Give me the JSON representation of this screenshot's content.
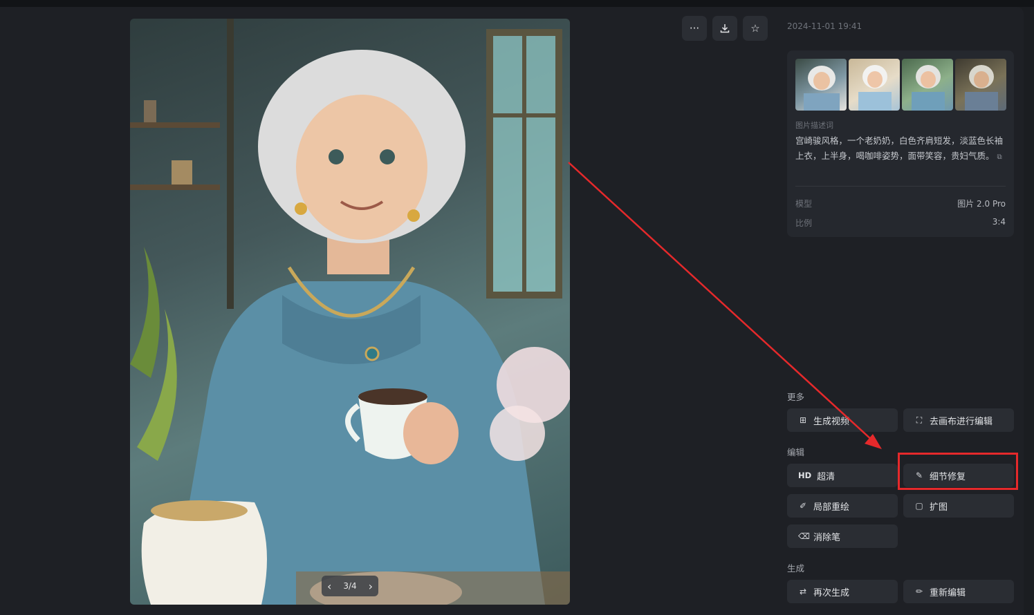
{
  "viewer": {
    "pager": {
      "current": "3/4",
      "prev_icon": "chevron-left-icon",
      "next_icon": "chevron-right-icon"
    }
  },
  "toolbar": {
    "more_icon": "ellipsis-icon",
    "download_icon": "download-icon",
    "favorite_icon": "star-icon"
  },
  "details": {
    "date": "2024-11-01 19:41",
    "thumbnail_count": 4,
    "prompt_label": "图片描述词",
    "prompt_text": "宫崎骏风格，一个老奶奶，白色齐肩短发，淡蓝色长袖上衣，上半身，喝咖啡姿势，面带笑容，贵妇气质。",
    "model_key": "模型",
    "model_value": "图片 2.0 Pro",
    "ratio_key": "比例",
    "ratio_value": "3:4"
  },
  "actions": {
    "more_label": "更多",
    "generate_video": "生成视频",
    "canvas_edit": "去画布进行编辑",
    "edit_label": "编辑",
    "hd_badge": "HD",
    "upscale": "超清",
    "detail_fix": "细节修复",
    "inpaint": "局部重绘",
    "outpaint": "扩图",
    "eraser": "消除笔",
    "generate_label": "生成",
    "regenerate": "再次生成",
    "reedit": "重新编辑"
  },
  "colors": {
    "background": "#1e2025",
    "panel": "#25282e",
    "button": "#2a2d33",
    "annotation_red": "#e5292b"
  }
}
